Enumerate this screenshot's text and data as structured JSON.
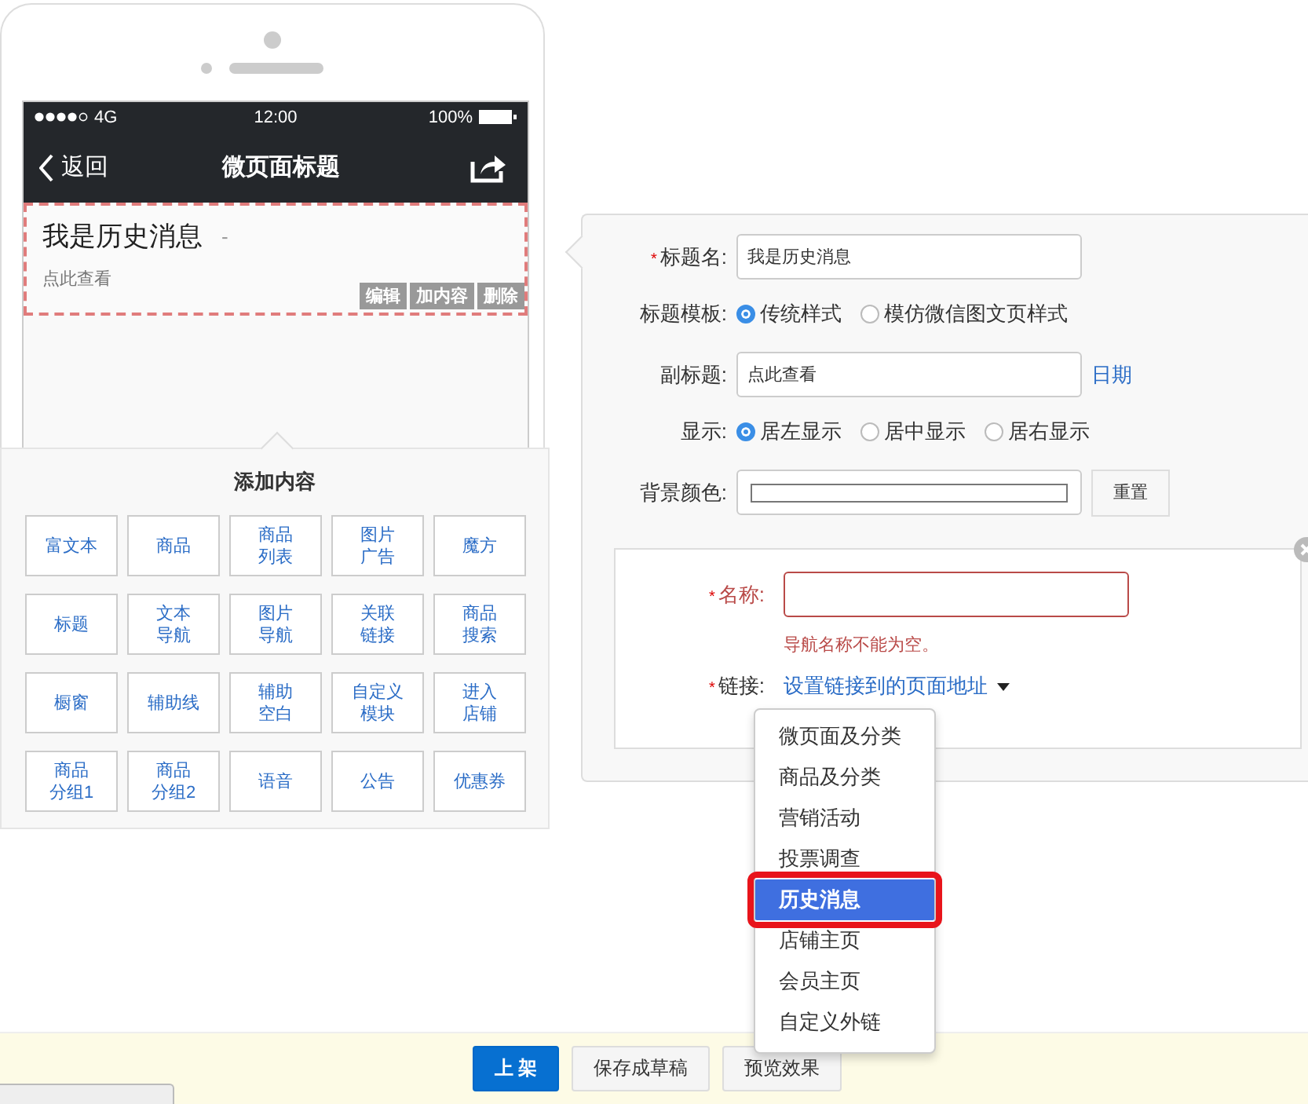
{
  "phone": {
    "status_bar": {
      "network": "4G",
      "time": "12:00",
      "battery": "100%"
    },
    "nav": {
      "back": "返回",
      "title": "微页面标题"
    },
    "preview": {
      "title": "我是历史消息",
      "dash": "-",
      "subtitle": "点此查看",
      "actions": [
        "编辑",
        "加内容",
        "删除"
      ]
    }
  },
  "add_content": {
    "title": "添加内容",
    "items": [
      {
        "lines": [
          "富文本"
        ]
      },
      {
        "lines": [
          "商品"
        ]
      },
      {
        "lines": [
          "商品",
          "列表"
        ]
      },
      {
        "lines": [
          "图片",
          "广告"
        ]
      },
      {
        "lines": [
          "魔方"
        ]
      },
      {
        "lines": [
          "标题"
        ]
      },
      {
        "lines": [
          "文本",
          "导航"
        ]
      },
      {
        "lines": [
          "图片",
          "导航"
        ]
      },
      {
        "lines": [
          "关联",
          "链接"
        ]
      },
      {
        "lines": [
          "商品",
          "搜索"
        ]
      },
      {
        "lines": [
          "橱窗"
        ]
      },
      {
        "lines": [
          "辅助线"
        ]
      },
      {
        "lines": [
          "辅助",
          "空白"
        ]
      },
      {
        "lines": [
          "自定义",
          "模块"
        ]
      },
      {
        "lines": [
          "进入",
          "店铺"
        ]
      },
      {
        "lines": [
          "商品",
          "分组1"
        ]
      },
      {
        "lines": [
          "商品",
          "分组2"
        ]
      },
      {
        "lines": [
          "语音"
        ]
      },
      {
        "lines": [
          "公告"
        ]
      },
      {
        "lines": [
          "优惠券"
        ]
      }
    ]
  },
  "editor": {
    "title_name": {
      "required_mark": "*",
      "label": "标题名:",
      "value": "我是历史消息"
    },
    "template": {
      "label": "标题模板:",
      "options": [
        {
          "label": "传统样式",
          "selected": true
        },
        {
          "label": "模仿微信图文页样式",
          "selected": false
        }
      ]
    },
    "subtitle": {
      "label": "副标题:",
      "value": "点此查看",
      "link": "日期"
    },
    "display": {
      "label": "显示:",
      "options": [
        {
          "label": "居左显示",
          "selected": true
        },
        {
          "label": "居中显示",
          "selected": false
        },
        {
          "label": "居右显示",
          "selected": false
        }
      ]
    },
    "bg_color": {
      "label": "背景颜色:",
      "button": "重置"
    },
    "nav_item": {
      "name_mark": "*",
      "name_label": "名称:",
      "error": "导航名称不能为空。",
      "link_mark": "*",
      "link_label": "链接:",
      "link": "设置链接到的页面地址"
    },
    "dropdown": [
      {
        "label": "微页面及分类",
        "selected": false
      },
      {
        "label": "商品及分类",
        "selected": false
      },
      {
        "label": "营销活动",
        "selected": false
      },
      {
        "label": "投票调查",
        "selected": false
      },
      {
        "label": "历史消息",
        "selected": true
      },
      {
        "label": "店铺主页",
        "selected": false
      },
      {
        "label": "会员主页",
        "selected": false
      },
      {
        "label": "自定义外链",
        "selected": false
      }
    ]
  },
  "bottom_bar": {
    "buttons": [
      {
        "label": "上 架",
        "kind": "primary"
      },
      {
        "label": "保存成草稿",
        "kind": "default"
      },
      {
        "label": "预览效果",
        "kind": "default"
      }
    ]
  }
}
